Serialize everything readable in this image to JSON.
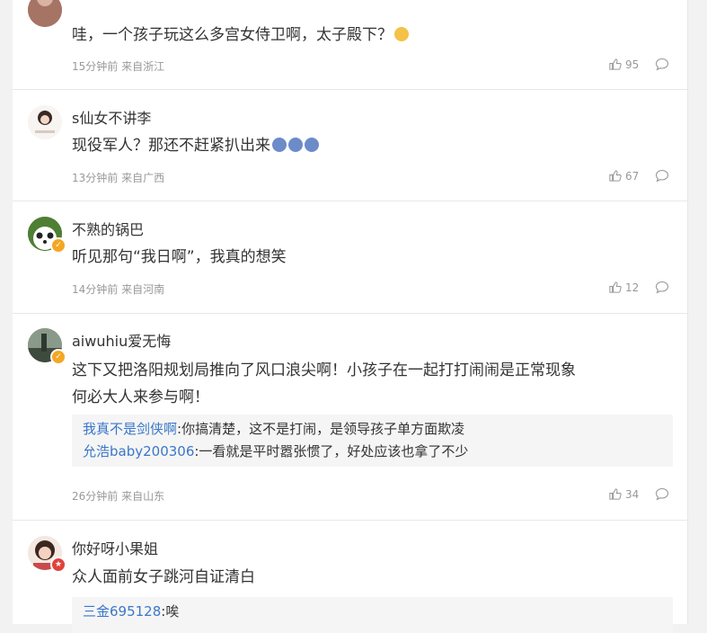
{
  "comments": [
    {
      "text": "哇，一个孩子玩这么多宫女侍卫啊，太子殿下？",
      "emoji": "grinning-cat-emoji",
      "time": "15分钟前 来自浙江",
      "likes": "95"
    },
    {
      "username": "s仙女不讲李",
      "text": "现役军人？那还不赶紧扒出来",
      "emoji": "panda-face-emoji",
      "time": "13分钟前 来自广西",
      "likes": "67"
    },
    {
      "username": "不熟的锅巴",
      "text": "听见那句“我日啊”，我真的想笑",
      "time": "14分钟前 来自河南",
      "likes": "12"
    },
    {
      "username": "aiwuhiu爱无悔",
      "text_line1": "这下又把洛阳规划局推向了风口浪尖啊！小孩子在一起打打闹闹是正常现象",
      "text_line2": "何必大人来参与啊！",
      "replies": [
        {
          "user": "我真不是剑侠啊",
          "text": ":你搞清楚，这不是打闹，是领导孩子单方面欺凌"
        },
        {
          "user": "允浩baby200306",
          "text": ":一看就是平时嚣张惯了，好处应该也拿了不少"
        }
      ],
      "time": "26分钟前 来自山东",
      "likes": "34"
    },
    {
      "username": "你好呀小果姐",
      "text": "众人面前女子跳河自证清白",
      "replies": [
        {
          "user": "三金695128",
          "text": ":唉"
        }
      ]
    }
  ],
  "colors": {
    "link": "#3b77c8",
    "text": "#333333",
    "meta": "#999999",
    "vip_badge": "#f5a623",
    "red_badge": "#e0433c"
  }
}
